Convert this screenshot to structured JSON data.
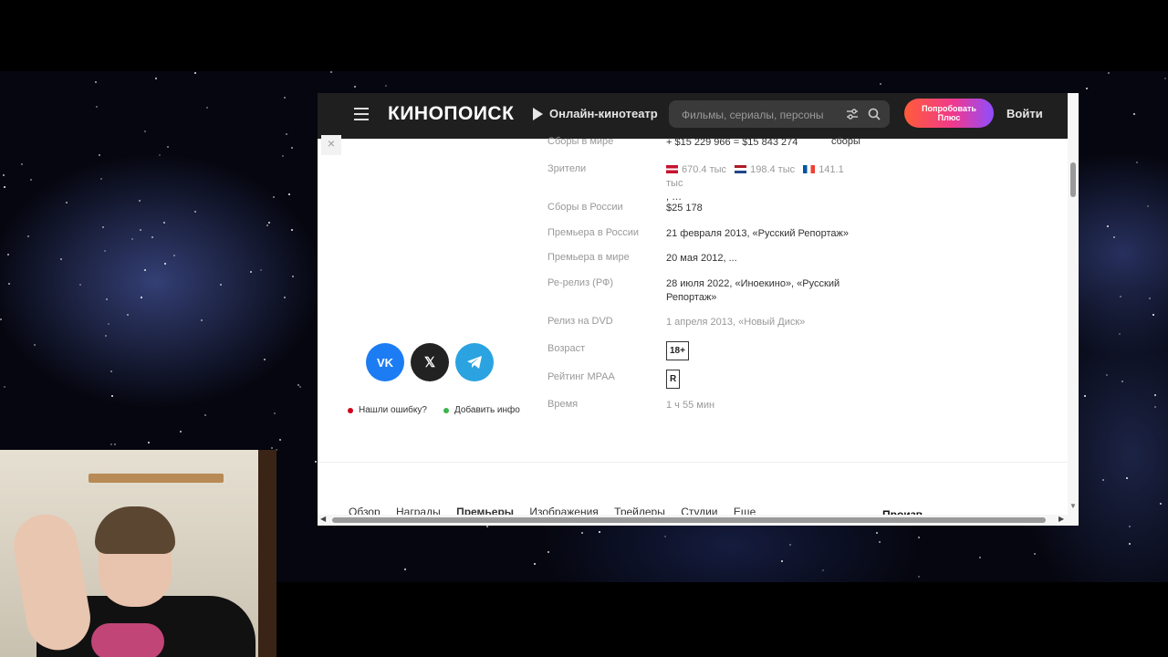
{
  "header": {
    "logo": "КИНОПОИСК",
    "online_cinema": "Онлайн-кинотеатр",
    "search_placeholder": "Фильмы, сериалы, персоны",
    "plus_button": "Попробовать\nПлюс",
    "login": "Войти"
  },
  "details": {
    "worldwide": {
      "label": "Сборы в мире",
      "value": "+ $15 229 966 = $15 843 274",
      "extra": "сборы"
    },
    "viewers": {
      "label": "Зрители",
      "entries": [
        {
          "flag": "denmark",
          "value": "670.4 тыс"
        },
        {
          "flag": "netherlands",
          "value": "198.4 тыс"
        },
        {
          "flag": "france",
          "value": "141.1 тыс"
        }
      ],
      "more": ", …"
    },
    "russia_gross": {
      "label": "Сборы в России",
      "value": "$25 178"
    },
    "premiere_russia": {
      "label": "Премьера в России",
      "value": "21 февраля 2013, «Русский Репортаж»"
    },
    "premiere_world": {
      "label": "Премьера в мире",
      "value": "20 мая 2012, ..."
    },
    "rerelease": {
      "label": "Ре-релиз (РФ)",
      "value": "28 июля 2022, «Иноекино», «Русский Репортаж»"
    },
    "dvd": {
      "label": "Релиз на DVD",
      "value": "1 апреля 2013, «Новый Диск»"
    },
    "age": {
      "label": "Возраст",
      "value": "18+"
    },
    "mpaa": {
      "label": "Рейтинг MPAA",
      "value": "R"
    },
    "runtime": {
      "label": "Время",
      "value": "1 ч 55 мин"
    }
  },
  "social": {
    "vk": "VK",
    "x": "𝕏"
  },
  "report": {
    "error": "Нашли ошибку?",
    "add": "Добавить инфо"
  },
  "tabs": [
    "Обзор",
    "Награды",
    "Премьеры",
    "Изображения",
    "Трейлеры",
    "Студии",
    "Еще"
  ],
  "tabs_right": "Произв",
  "colors": {
    "plus_gradient": [
      "#ff5c38",
      "#f0398e",
      "#8f4dff"
    ],
    "vk": "#1c7cf4",
    "telegram": "#2aa3e0"
  }
}
